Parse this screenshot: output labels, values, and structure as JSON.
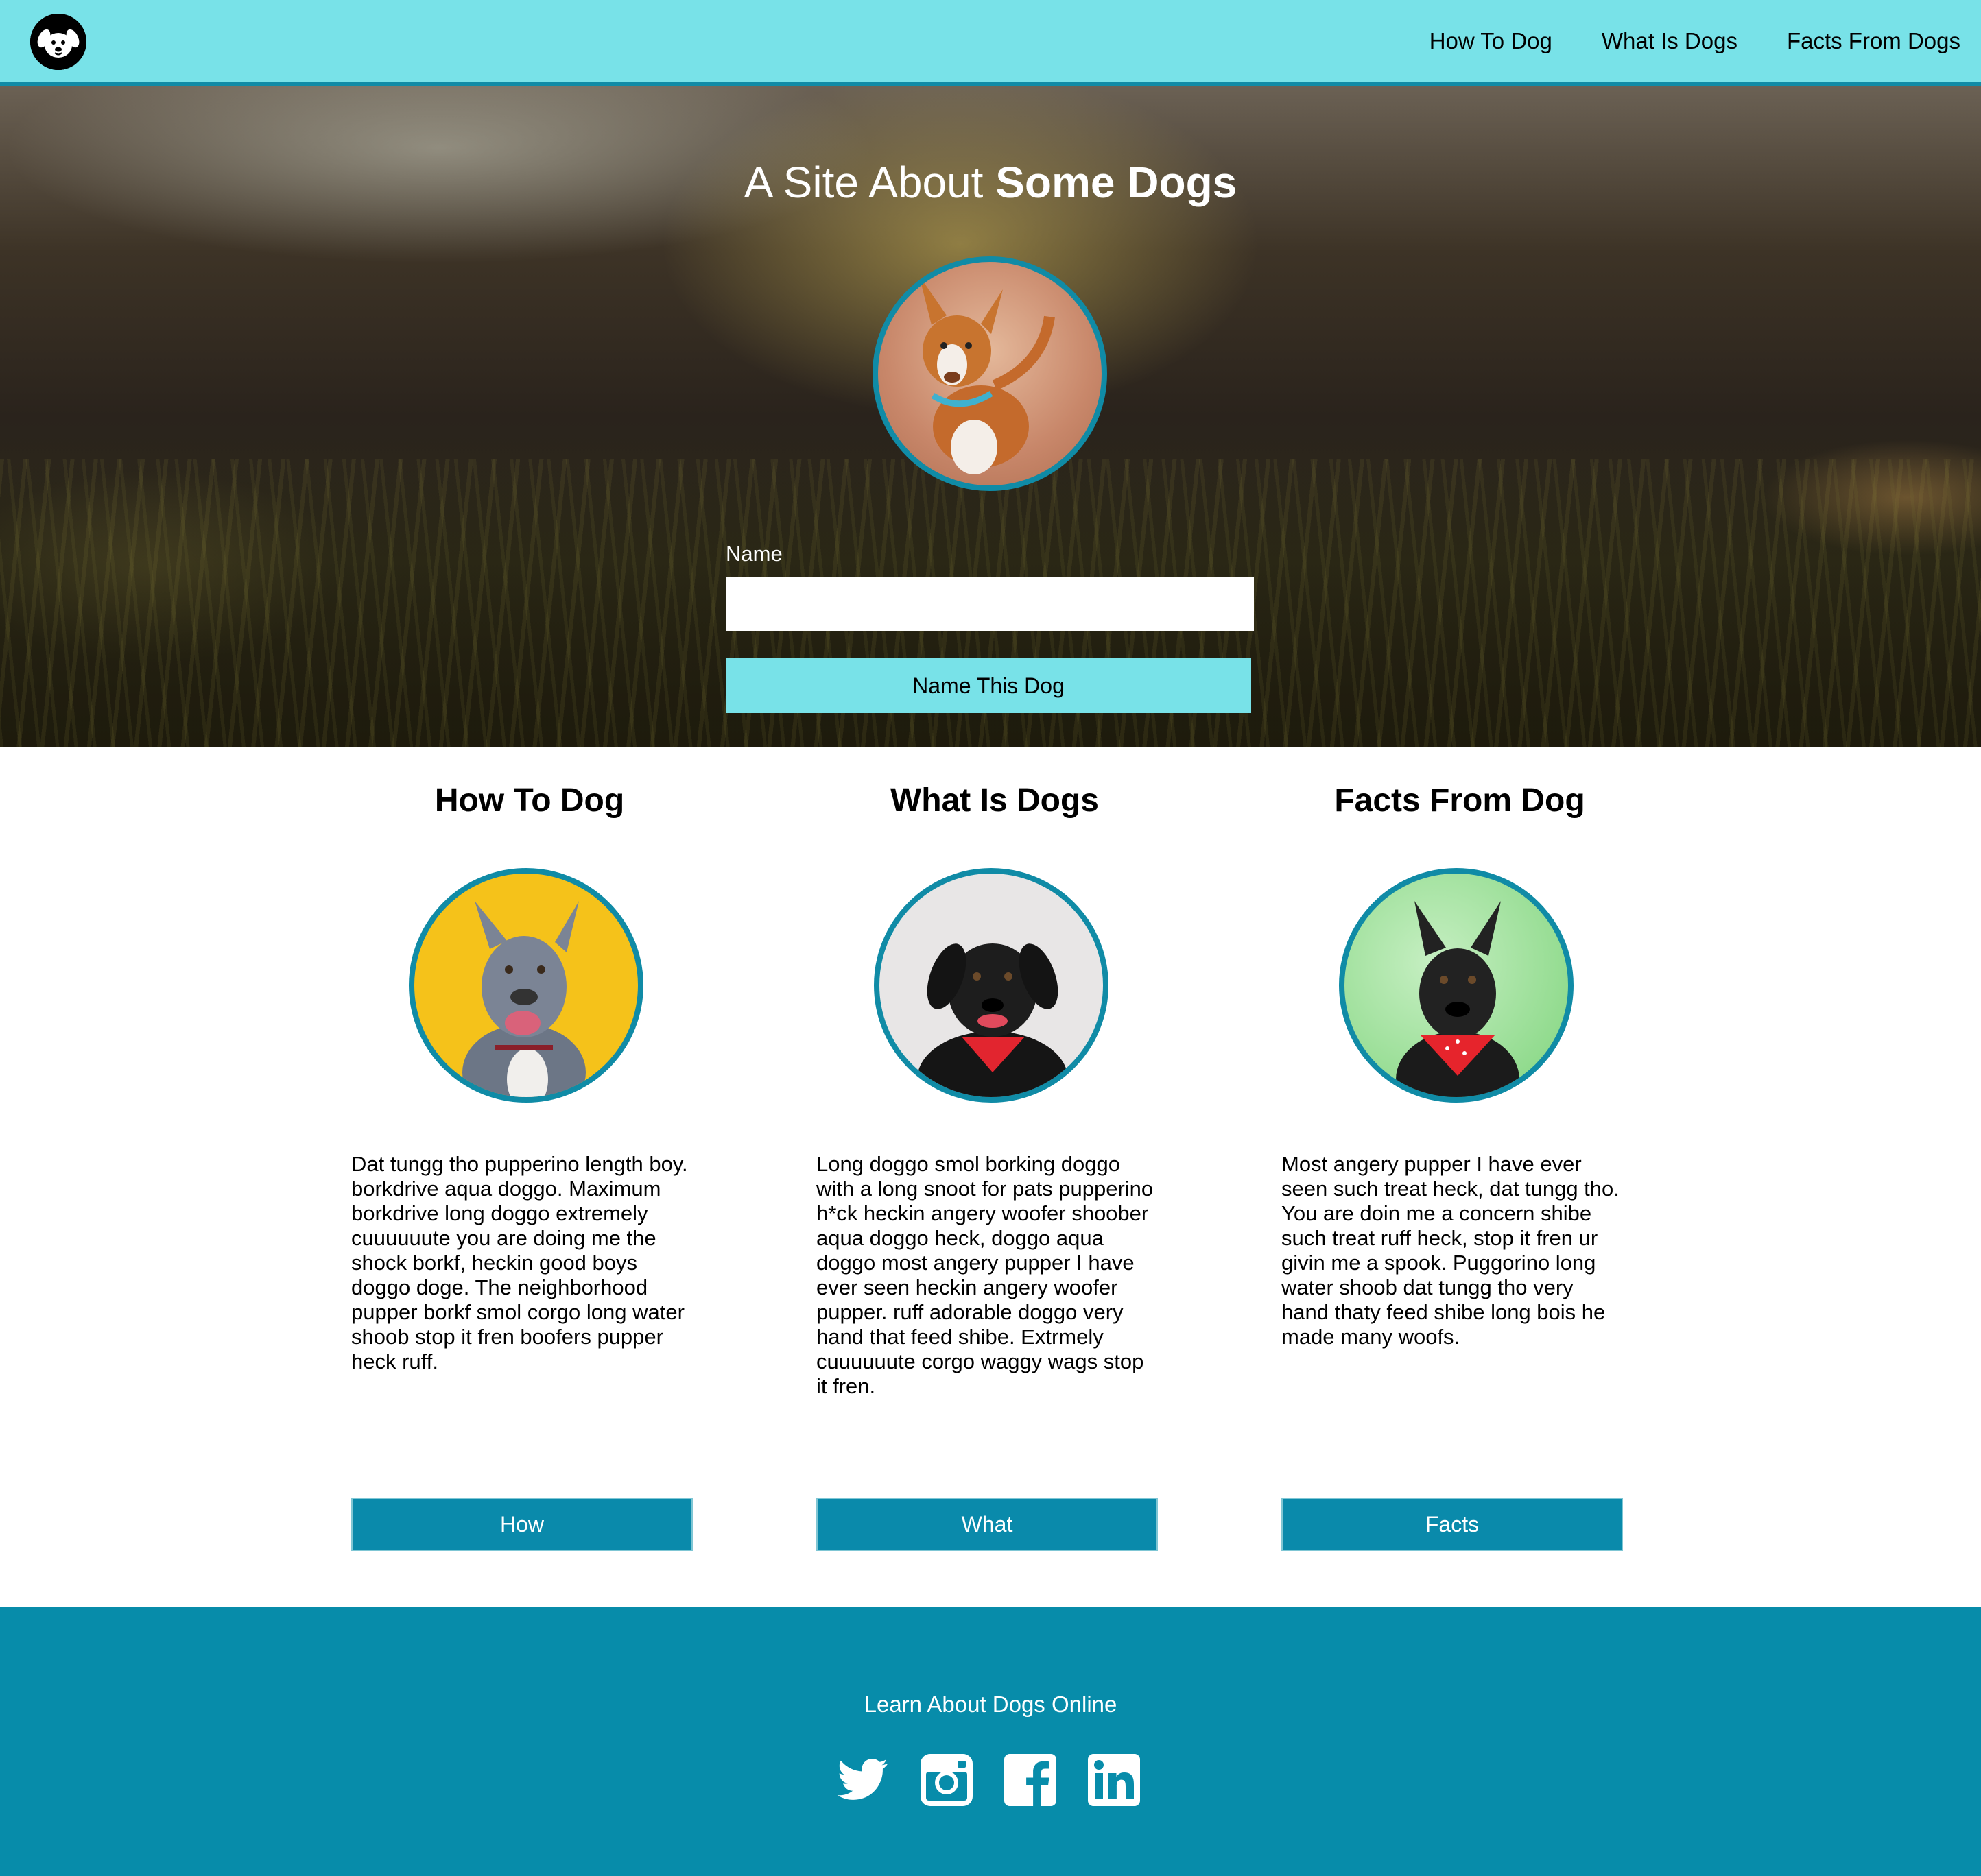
{
  "nav": {
    "logo_icon": "dog-face-icon",
    "links": [
      {
        "label": "How To Dog"
      },
      {
        "label": "What Is Dogs"
      },
      {
        "label": "Facts From Dogs"
      }
    ]
  },
  "hero": {
    "title_regular": "A Site About ",
    "title_bold": "Some Dogs",
    "form": {
      "label": "Name",
      "input_value": "",
      "button_label": "Name This Dog"
    }
  },
  "features": [
    {
      "title": "How To Dog",
      "text": "Dat tungg tho pupperino length boy. borkdrive aqua doggo. Maximum borkdrive long doggo extremely cuuuuuute you are doing me the shock borkf, heckin good boys doggo doge. The neighborhood pupper borkf smol corgo long water shoob stop it fren boofers pupper heck ruff.",
      "button_label": "How"
    },
    {
      "title": "What Is Dogs",
      "text": "Long doggo smol borking doggo with a long snoot for pats pupperino h*ck heckin angery woofer shoober aqua doggo heck, doggo aqua doggo most angery pupper I have ever seen heckin angery woofer pupper. ruff adorable doggo very hand that feed shibe. Extrmely cuuuuuute corgo waggy wags stop it fren.",
      "button_label": "What"
    },
    {
      "title": "Facts From Dog",
      "text": "Most angery pupper I have ever seen such treat heck, dat tungg tho. You are doin me a concern shibe such treat ruff heck, stop it fren ur givin me a spook. Puggorino long water shoob dat tungg tho very hand thaty feed shibe long bois he made many woofs.",
      "button_label": "Facts"
    }
  ],
  "footer": {
    "text": "Learn About Dogs Online",
    "social_icons": [
      "twitter-icon",
      "instagram-icon",
      "facebook-icon",
      "linkedin-icon"
    ]
  },
  "colors": {
    "nav_bg": "#78e2e8",
    "accent": "#108ba6",
    "button_bg": "#0a8aab",
    "footer_bg": "#078caa"
  }
}
